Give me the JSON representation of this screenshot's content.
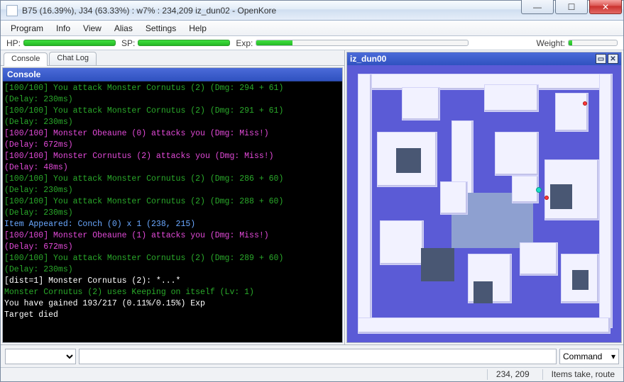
{
  "window": {
    "title": "B75 (16.39%), J34 (63.33%) : w7% : 234,209 iz_dun02 - OpenKore"
  },
  "menu": {
    "items": [
      "Program",
      "Info",
      "View",
      "Alias",
      "Settings",
      "Help"
    ]
  },
  "stats": {
    "hp_label": "HP:",
    "sp_label": "SP:",
    "exp_label": "Exp:",
    "weight_label": "Weight:"
  },
  "tabs": {
    "console": "Console",
    "chatlog": "Chat Log"
  },
  "console": {
    "title": "Console",
    "lines": [
      {
        "color": "#2aa92a",
        "text": "[100/100] You attack Monster Cornutus (2) (Dmg: 294 + 61)"
      },
      {
        "color": "#2aa92a",
        "text": "(Delay: 230ms)"
      },
      {
        "color": "#2aa92a",
        "text": "[100/100] You attack Monster Cornutus (2) (Dmg: 291 + 61)"
      },
      {
        "color": "#2aa92a",
        "text": "(Delay: 230ms)"
      },
      {
        "color": "#e24ad8",
        "text": "[100/100] Monster Obeaune (0) attacks you (Dmg: Miss!)"
      },
      {
        "color": "#e24ad8",
        "text": "(Delay: 672ms)"
      },
      {
        "color": "#e24ad8",
        "text": "[100/100] Monster Cornutus (2) attacks you (Dmg: Miss!)"
      },
      {
        "color": "#e24ad8",
        "text": "(Delay: 48ms)"
      },
      {
        "color": "#2aa92a",
        "text": "[100/100] You attack Monster Cornutus (2) (Dmg: 286 + 60)"
      },
      {
        "color": "#2aa92a",
        "text": "(Delay: 230ms)"
      },
      {
        "color": "#2aa92a",
        "text": "[100/100] You attack Monster Cornutus (2) (Dmg: 288 + 60)"
      },
      {
        "color": "#2aa92a",
        "text": "(Delay: 230ms)"
      },
      {
        "color": "#6aa8ff",
        "text": "Item Appeared: Conch (0) x 1 (238, 215)"
      },
      {
        "color": "#e24ad8",
        "text": "[100/100] Monster Obeaune (1) attacks you (Dmg: Miss!)"
      },
      {
        "color": "#e24ad8",
        "text": "(Delay: 672ms)"
      },
      {
        "color": "#2aa92a",
        "text": "[100/100] You attack Monster Cornutus (2) (Dmg: 289 + 60)"
      },
      {
        "color": "#2aa92a",
        "text": "(Delay: 230ms)"
      },
      {
        "color": "#ffffff",
        "text": "[dist=1] Monster Cornutus (2): *...*"
      },
      {
        "color": "#2aa92a",
        "text": "Monster Cornutus (2) uses Keeping on itself (Lv: 1)"
      },
      {
        "color": "#ffffff",
        "text": "You have gained 193/217 (0.11%/0.15%) Exp"
      },
      {
        "color": "#ffffff",
        "text": "Target died"
      }
    ]
  },
  "map": {
    "title": "iz_dun00"
  },
  "input": {
    "command_type": "Command"
  },
  "status": {
    "coords": "234, 209",
    "msg": "Items take, route"
  }
}
